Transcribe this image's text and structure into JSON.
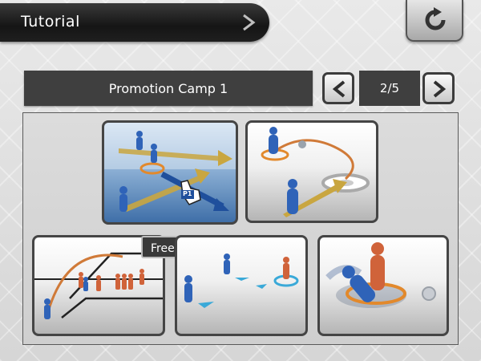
{
  "header": {
    "title": "Tutorial",
    "arrow_icon": "chevron-right-icon"
  },
  "reset": {
    "icon": "refresh-icon"
  },
  "camp": {
    "title": "Promotion Camp 1"
  },
  "pager": {
    "page": "2/5",
    "prev_icon": "chevron-left-icon",
    "next_icon": "chevron-right-icon"
  },
  "thumbnails": [
    {
      "label": "",
      "selected": true,
      "cursor_tag": "P1"
    },
    {
      "label": "",
      "selected": false
    },
    {
      "label": "Free Run",
      "selected": false
    },
    {
      "label": "",
      "selected": false
    },
    {
      "label": "",
      "selected": false
    }
  ],
  "colors": {
    "player_blue": "#2f63b8",
    "opponent_orange": "#d0633a",
    "arrow_gold": "#c9a640",
    "ring_orange": "#e2892c",
    "ring_cyan": "#3aa9d8"
  }
}
